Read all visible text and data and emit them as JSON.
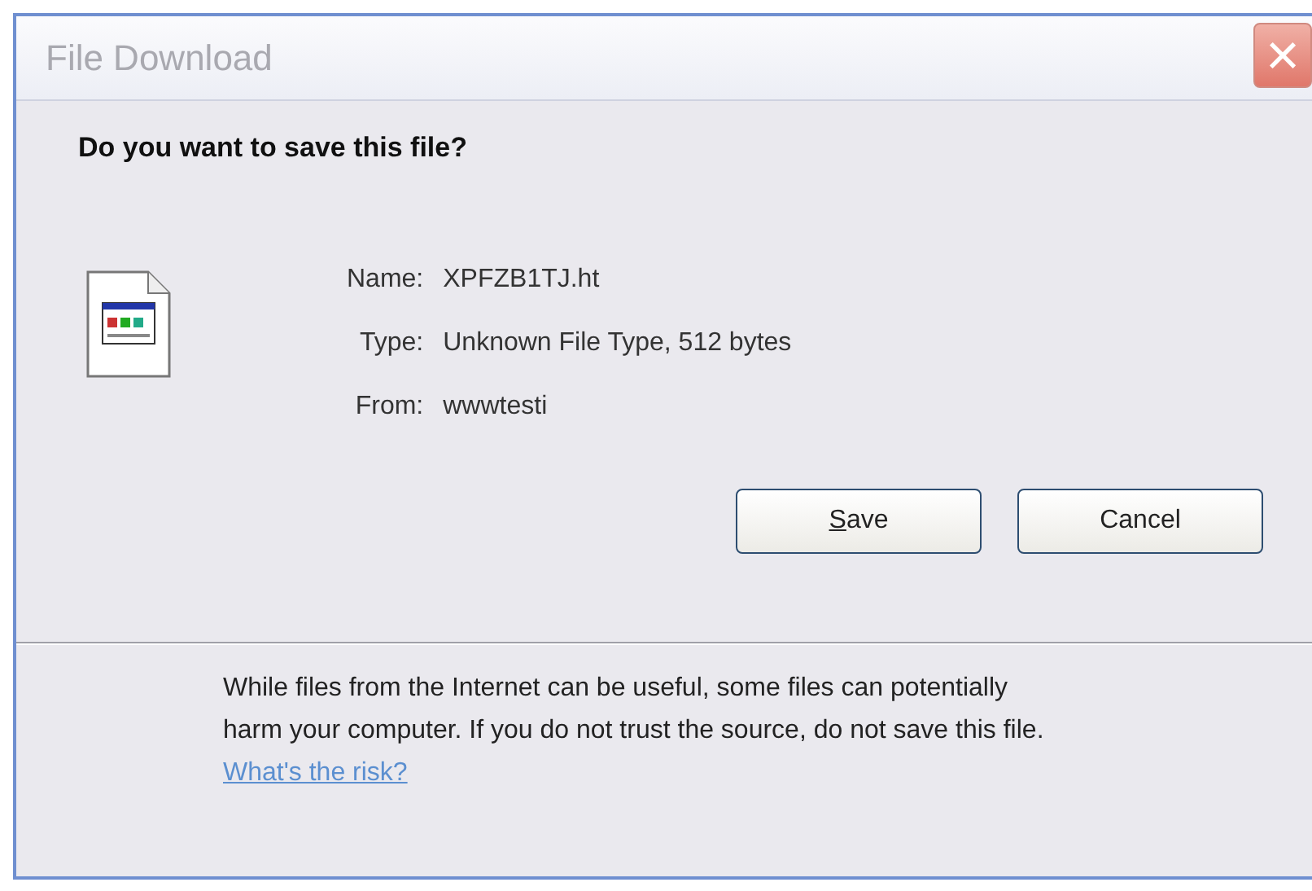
{
  "window": {
    "title": "File Download",
    "close_button": "×"
  },
  "heading": "Do you want to save this file?",
  "file_details": [
    {
      "label": "Name:",
      "value": "XPFZB1TJ.ht"
    },
    {
      "label": "Type:",
      "value": "Unknown File Type, 512 bytes"
    },
    {
      "label": "From:",
      "value": "wwwtesti"
    }
  ],
  "buttons": [
    {
      "label": "Save",
      "underline_first": true
    },
    {
      "label": "Cancel"
    }
  ],
  "warning": {
    "text": "While files from the Internet can be useful, some files can potentially harm your computer. If you do not trust the source, do not save this file.",
    "link": "What's the risk?"
  }
}
